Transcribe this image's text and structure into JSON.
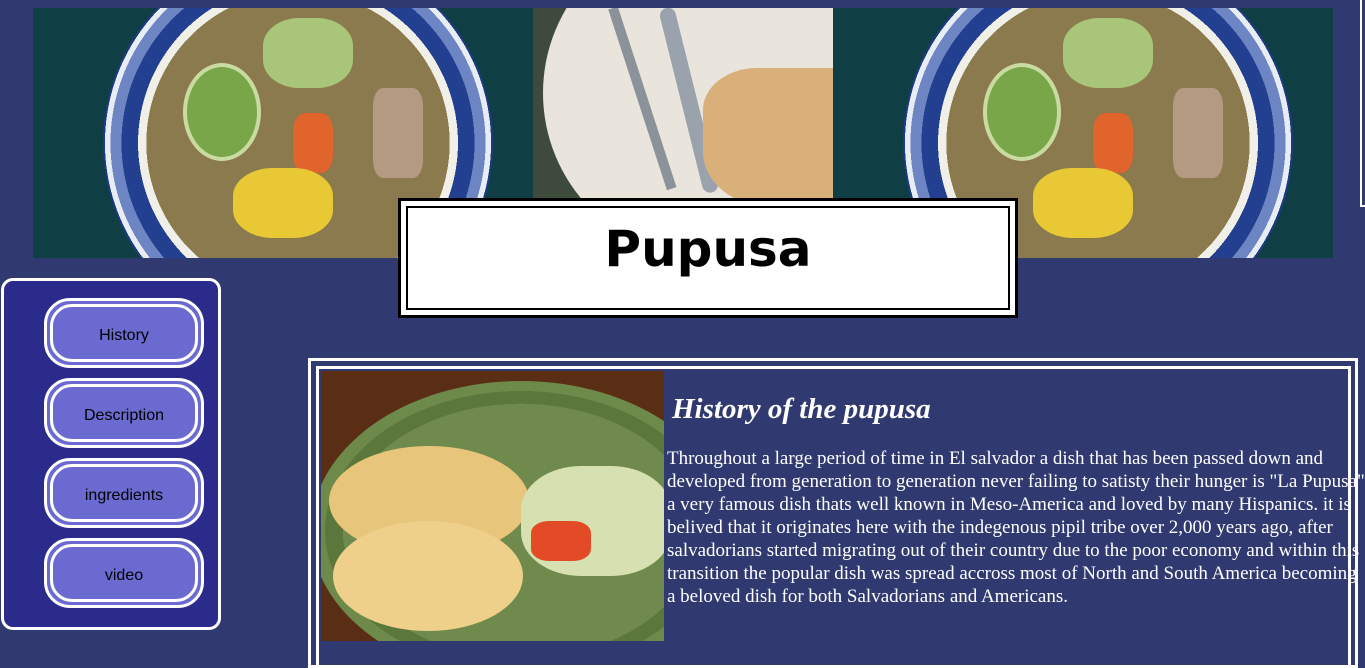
{
  "page": {
    "title": "Pupusa"
  },
  "sidebar": {
    "items": [
      {
        "label": "History"
      },
      {
        "label": "Description"
      },
      {
        "label": "ingredients"
      },
      {
        "label": "video"
      }
    ]
  },
  "content": {
    "heading": "History of the pupusa",
    "paragraph": "Throughout a large period of time in El salvador a dish that has been passed down and developed from generation to generation never failing to satisty their hunger is \"La Pupusa\" a very famous dish thats well known in Meso-America and loved by many Hispanics. it is belived that it originates here with the indegenous pipil tribe over 2,000 years ago, after salvadorians started migrating out of their country due to the poor economy and within this transition the popular dish was spread accross most of North and South America becoming a beloved dish for both Salvadorians and Americans."
  },
  "colors": {
    "background": "#313a70",
    "sidebar": "#2b2b8c",
    "button": "#6a6ad0"
  }
}
